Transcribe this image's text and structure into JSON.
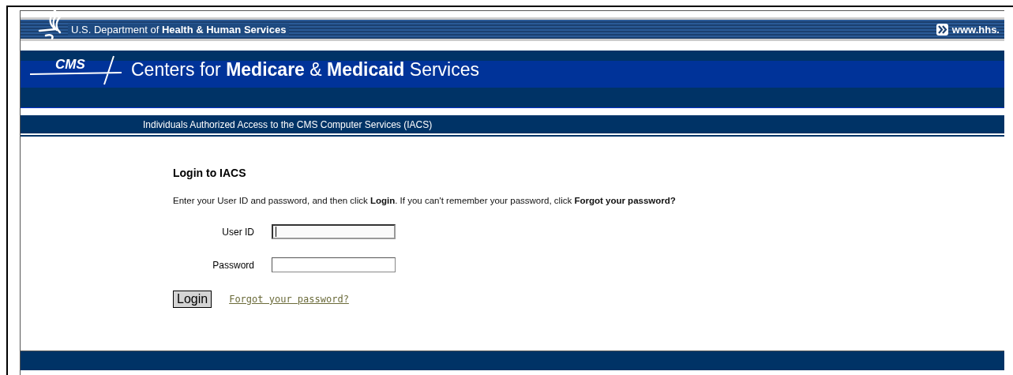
{
  "agency_bar": {
    "title": "U.S. Department of **Health & Human Services**",
    "link": "www.hhs."
  },
  "banner": {
    "logo": "CMS",
    "title": "Centers for **Medicare** & **Medicaid** Services"
  },
  "subtitle_bar": {
    "title": "Individuals Authorized Access to the CMS Computer Services (IACS)"
  },
  "login": {
    "heading": "Login to IACS",
    "instructions": "Enter your User ID and password, and then click **Login**. If you can't remember your password, click **Forgot your password?**",
    "fields": [
      {
        "label": "User ID",
        "focused": true
      },
      {
        "label": "Password",
        "focused": false
      }
    ],
    "submit": "Login",
    "forgot_link": "Forgot your password?"
  }
}
